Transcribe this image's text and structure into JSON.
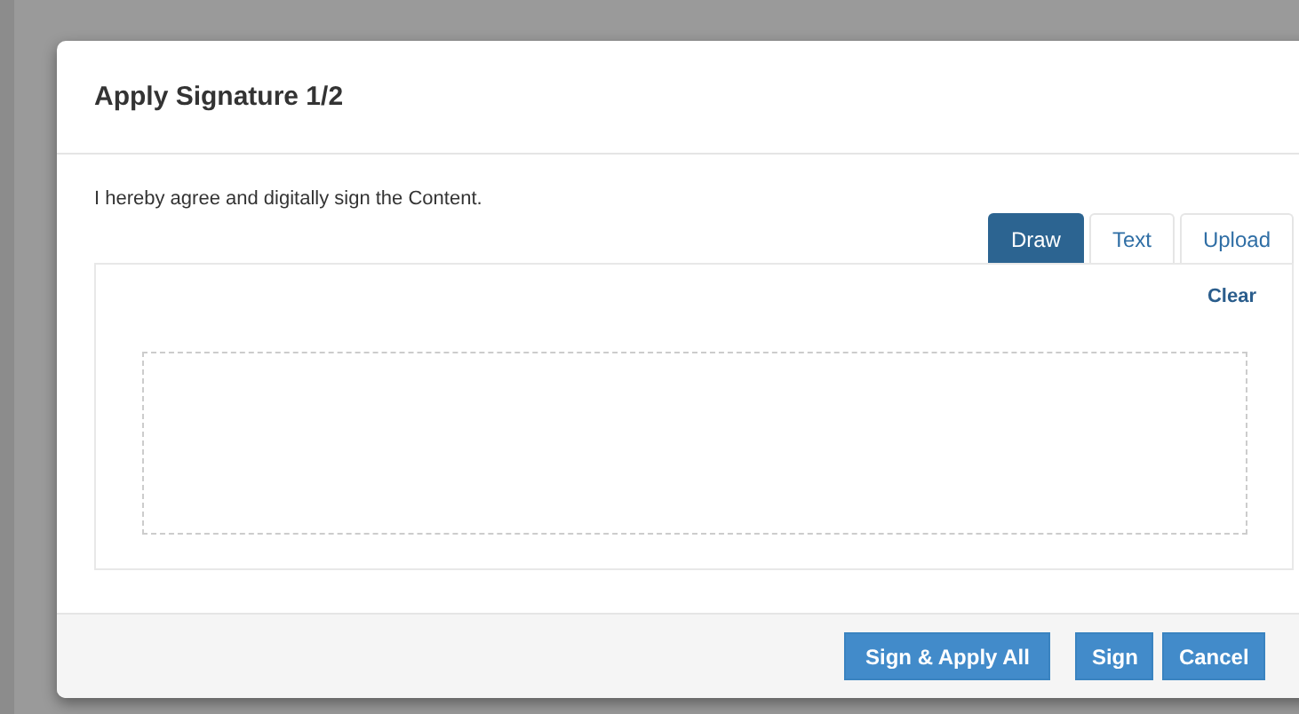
{
  "dialog": {
    "title": "Apply Signature 1/2",
    "statement": "I hereby agree and digitally sign the Content.",
    "tabs": [
      {
        "label": "Draw",
        "selected": true
      },
      {
        "label": "Text",
        "selected": false
      },
      {
        "label": "Upload",
        "selected": false
      }
    ],
    "clear_link": "Clear",
    "buttons": [
      "Sign & Apply All",
      "Sign",
      "Cancel"
    ]
  }
}
